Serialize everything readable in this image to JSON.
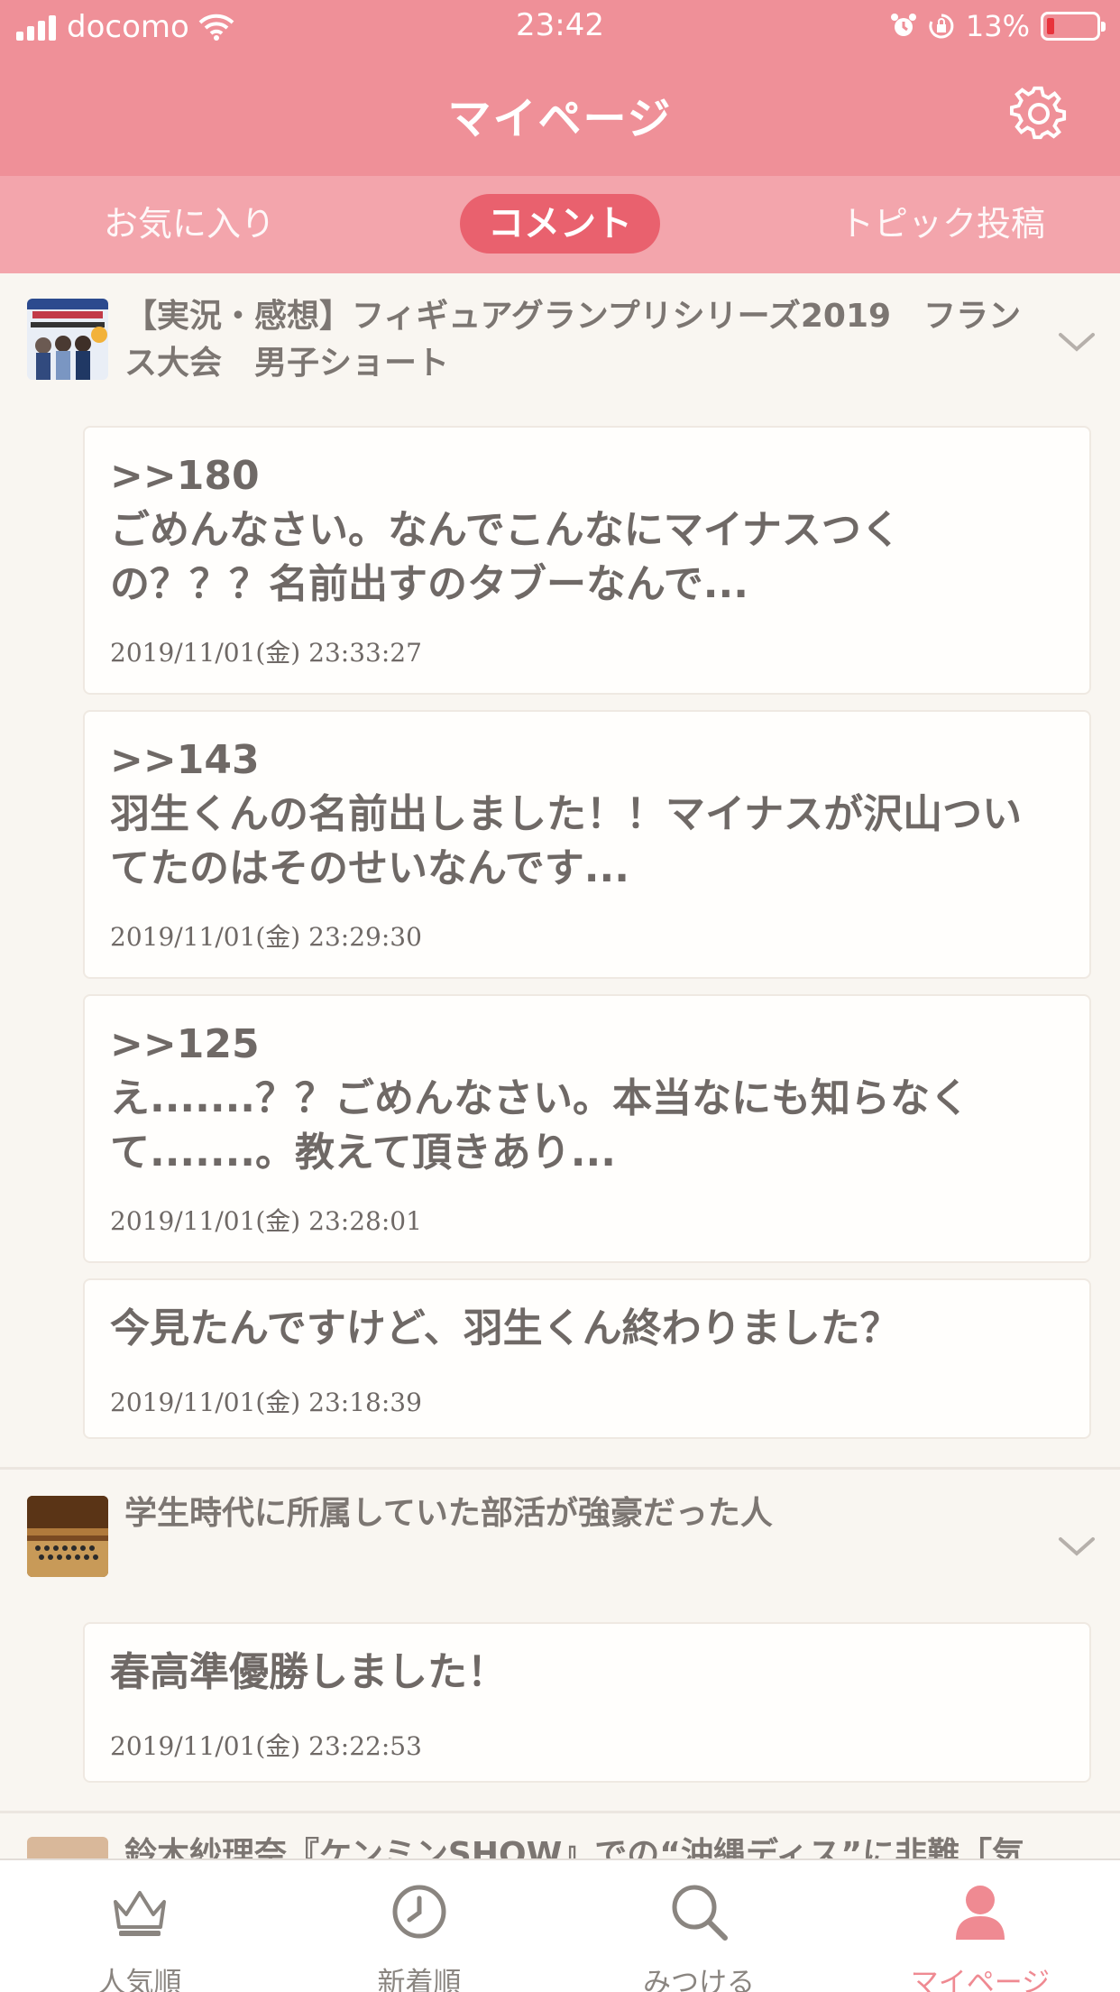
{
  "status_bar": {
    "carrier": "docomo",
    "time": "23:42",
    "battery": "13%",
    "icons": [
      "signal-icon",
      "wifi-icon",
      "alarm-icon",
      "rotation-lock-icon",
      "battery-icon"
    ]
  },
  "header": {
    "title": "マイページ",
    "settings_icon": "gear-icon"
  },
  "tabs": [
    {
      "label": "お気に入り",
      "selected": false
    },
    {
      "label": "コメント",
      "selected": true
    },
    {
      "label": "トピック投稿",
      "selected": false
    }
  ],
  "topics": [
    {
      "title": "【実況・感想】フィギュアグランプリシリーズ2019　フランス大会　男子ショート",
      "title_lines": [
        "【実況・感想】フィギュアグランプリシリーズ2019　フラン",
        "ス大会　男子ショート"
      ],
      "comments": [
        {
          "lines": [
            ">>180",
            "ごめんなさい。なんでこんなにマイナスつく",
            "の？？？名前出すのタブーなんで..."
          ],
          "date": "2019/11/01(金) 23:33:27"
        },
        {
          "lines": [
            ">>143",
            "羽生くんの名前出しました！！マイナスが沢山つい",
            "てたのはそのせいなんです..."
          ],
          "date": "2019/11/01(金) 23:29:30"
        },
        {
          "lines": [
            ">>125",
            "え.......？？ごめんなさい。本当なにも知らなく",
            "て.......。教えて頂きあり..."
          ],
          "date": "2019/11/01(金) 23:28:01"
        },
        {
          "lines": [
            "今見たんですけど、羽生くん終わりました？"
          ],
          "date": "2019/11/01(金) 23:18:39"
        }
      ]
    },
    {
      "title": "学生時代に所属していた部活が強豪だった人",
      "title_lines": [
        "学生時代に所属していた部活が強豪だった人"
      ],
      "comments": [
        {
          "lines": [
            "春高準優勝しました！"
          ],
          "date": "2019/11/01(金) 23:22:53"
        }
      ]
    },
    {
      "title": "鈴木紗理奈『ケンミンSHOW』での“沖縄ディス”に非難「気分",
      "title_lines": [
        "鈴木紗理奈『ケンミンSHOW』での“沖縄ディス”に非難「気分"
      ]
    }
  ],
  "bottom_nav": [
    {
      "label": "人気順",
      "icon": "crown-icon",
      "active": false
    },
    {
      "label": "新着順",
      "icon": "clock-icon",
      "active": false
    },
    {
      "label": "みつける",
      "icon": "search-icon",
      "active": false
    },
    {
      "label": "マイページ",
      "icon": "person-icon",
      "active": true
    }
  ],
  "colors": {
    "header_bg": "#ef9098",
    "tabs_bg": "#f3a5ac",
    "selected_tab_bg": "#e9616e",
    "active_nav": "#ef8a92",
    "page_bg": "#f9f6f1"
  }
}
